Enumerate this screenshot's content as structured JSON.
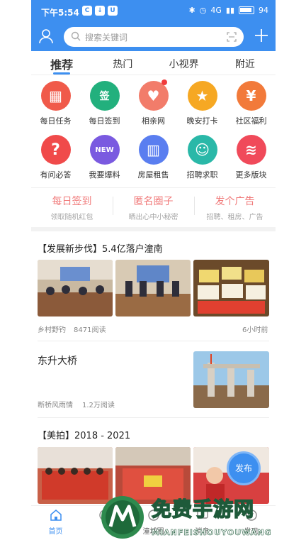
{
  "status_bar": {
    "time": "下午5:54",
    "network": "4G",
    "battery": "94"
  },
  "search": {
    "placeholder": "搜索关键词"
  },
  "tabs": [
    {
      "label": "推荐",
      "active": true
    },
    {
      "label": "热门",
      "active": false
    },
    {
      "label": "小视界",
      "active": false
    },
    {
      "label": "附近",
      "active": false
    }
  ],
  "grid": [
    {
      "label": "每日任务",
      "icon": "calendar-icon",
      "color": "#f05a4a",
      "glyph": "▦"
    },
    {
      "label": "每日签到",
      "icon": "sign-in-icon",
      "color": "#22b07d",
      "glyph": "签"
    },
    {
      "label": "相亲网",
      "icon": "heart-icon",
      "color": "#f27c6a",
      "glyph": "♥"
    },
    {
      "label": "晚安打卡",
      "icon": "star-icon",
      "color": "#f6a823",
      "glyph": "★"
    },
    {
      "label": "社区福利",
      "icon": "gift-icon",
      "color": "#f27a3a",
      "glyph": "¥"
    },
    {
      "label": "有问必答",
      "icon": "question-icon",
      "color": "#f04a4a",
      "glyph": "?"
    },
    {
      "label": "我要爆料",
      "icon": "new-icon",
      "color": "#7a5ae0",
      "glyph": "NEW"
    },
    {
      "label": "房屋租售",
      "icon": "building-icon",
      "color": "#5a7ef0",
      "glyph": "▥"
    },
    {
      "label": "招聘求职",
      "icon": "job-icon",
      "color": "#2ab8a8",
      "glyph": "☺"
    },
    {
      "label": "更多版块",
      "icon": "layers-icon",
      "color": "#f04a5a",
      "glyph": "≋"
    }
  ],
  "promo": [
    {
      "title": "每日签到",
      "sub": "领取随机红包"
    },
    {
      "title": "匿名圈子",
      "sub": "晒出心中小秘密"
    },
    {
      "title": "发个广告",
      "sub": "招聘、租房、广告"
    }
  ],
  "feed": [
    {
      "title": "【发展新步伐】5.4亿落户潼南",
      "author": "乡村野钓",
      "reads": "8471阅读",
      "time": "6小时前"
    },
    {
      "title": "东升大桥",
      "author": "断桥风雨情",
      "reads": "1.2万阅读"
    },
    {
      "title": "【美拍】2018 - 2021"
    }
  ],
  "publish_label": "发布",
  "bottom_nav": [
    {
      "label": "首页",
      "icon": "home-icon",
      "active": true
    },
    {
      "label": "",
      "icon": "compass-icon",
      "active": false
    },
    {
      "label": "潼城圈",
      "icon": "circle-icon",
      "active": false
    },
    {
      "label": "消息",
      "icon": "message-icon",
      "active": false
    },
    {
      "label": "发现",
      "icon": "discover-icon",
      "active": false
    }
  ],
  "watermark": {
    "title": "免费手游网",
    "sub": "MIANFEISHOUYOUWANG"
  },
  "colors": {
    "accent": "#3d8ff0",
    "promo_text": "#f07a7a"
  }
}
